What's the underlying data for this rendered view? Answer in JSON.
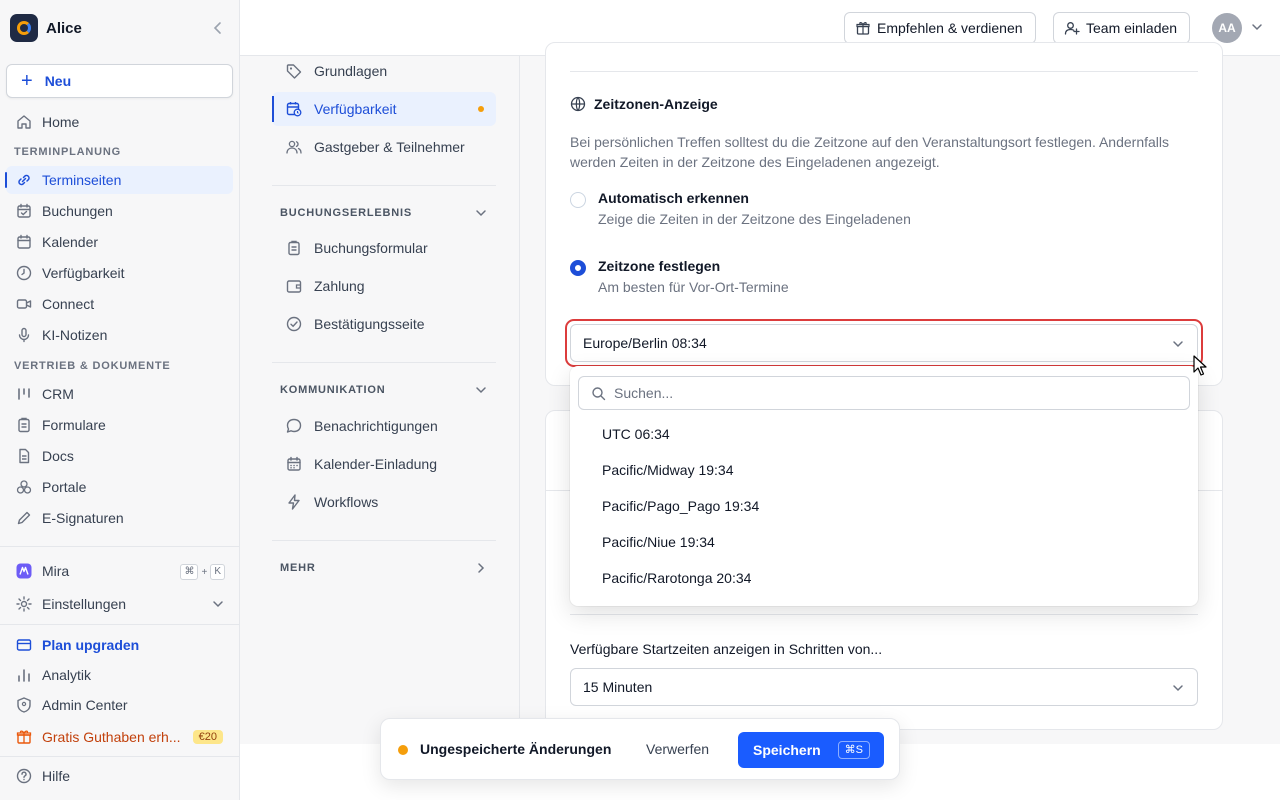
{
  "sidebar": {
    "workspace": "Alice",
    "new_label": "Neu",
    "items_top": [
      {
        "label": "Home",
        "icon": "home-icon"
      }
    ],
    "section_scheduling": "TERMINPLANUNG",
    "scheduling_items": [
      {
        "label": "Terminseiten",
        "icon": "link-icon",
        "active": true
      },
      {
        "label": "Buchungen",
        "icon": "calendar-check-icon"
      },
      {
        "label": "Kalender",
        "icon": "calendar-icon"
      },
      {
        "label": "Verfügbarkeit",
        "icon": "clock-icon"
      },
      {
        "label": "Connect",
        "icon": "video-icon"
      },
      {
        "label": "KI-Notizen",
        "icon": "microphone-icon"
      }
    ],
    "section_sales": "VERTRIEB & DOKUMENTE",
    "sales_items": [
      {
        "label": "CRM",
        "icon": "crm-icon"
      },
      {
        "label": "Formulare",
        "icon": "clipboard-icon"
      },
      {
        "label": "Docs",
        "icon": "document-icon"
      },
      {
        "label": "Portale",
        "icon": "portal-icon"
      },
      {
        "label": "E-Signaturen",
        "icon": "pen-icon"
      }
    ],
    "mira_label": "Mira",
    "mira_shortcut": [
      "⌘",
      "+",
      "K"
    ],
    "settings_label": "Einstellungen",
    "upgrade_label": "Plan upgraden",
    "analytics_label": "Analytik",
    "admin_label": "Admin Center",
    "promo_label": "Gratis Guthaben erh...",
    "promo_badge": "€20",
    "help_label": "Hilfe"
  },
  "topbar": {
    "referral_label": "Empfehlen & verdienen",
    "invite_label": "Team einladen",
    "avatar_initials": "AA"
  },
  "settings_nav": {
    "items_top": [
      {
        "label": "Grundlagen",
        "icon": "tag-icon"
      },
      {
        "label": "Verfügbarkeit",
        "icon": "calendar-clock-icon",
        "active": true
      },
      {
        "label": "Gastgeber & Teilnehmer",
        "icon": "users-icon"
      }
    ],
    "section_booking": "BUCHUNGSERLEBNIS",
    "booking_items": [
      {
        "label": "Buchungsformular",
        "icon": "clipboard-icon"
      },
      {
        "label": "Zahlung",
        "icon": "wallet-icon"
      },
      {
        "label": "Bestätigungsseite",
        "icon": "check-circle-icon"
      }
    ],
    "section_comm": "KOMMUNIKATION",
    "comm_items": [
      {
        "label": "Benachrichtigungen",
        "icon": "chat-icon"
      },
      {
        "label": "Kalender-Einladung",
        "icon": "calendar-icon"
      },
      {
        "label": "Workflows",
        "icon": "bolt-icon"
      }
    ],
    "section_more": "MEHR"
  },
  "timezone": {
    "title": "Zeitzonen-Anzeige",
    "description": "Bei persönlichen Treffen solltest du die Zeitzone auf den Veranstaltungsort festlegen. Andernfalls werden Zeiten in der Zeitzone des Eingeladenen angezeigt.",
    "option_auto_label": "Automatisch erkennen",
    "option_auto_sub": "Zeige die Zeiten in der Zeitzone des Eingeladenen",
    "option_fixed_label": "Zeitzone festlegen",
    "option_fixed_sub": "Am besten für Vor-Ort-Termine",
    "selected_value": "Europe/Berlin 08:34",
    "search_placeholder": "Suchen...",
    "options": [
      "UTC 06:34",
      "Pacific/Midway 19:34",
      "Pacific/Pago_Pago 19:34",
      "Pacific/Niue 19:34",
      "Pacific/Rarotonga 20:34"
    ]
  },
  "start_times": {
    "label": "Verfügbare Startzeiten anzeigen in Schritten von...",
    "value": "15 Minuten"
  },
  "savebar": {
    "unsaved_label": "Ungespeicherte Änderungen",
    "discard_label": "Verwerfen",
    "save_label": "Speichern",
    "save_shortcut": "⌘S"
  }
}
